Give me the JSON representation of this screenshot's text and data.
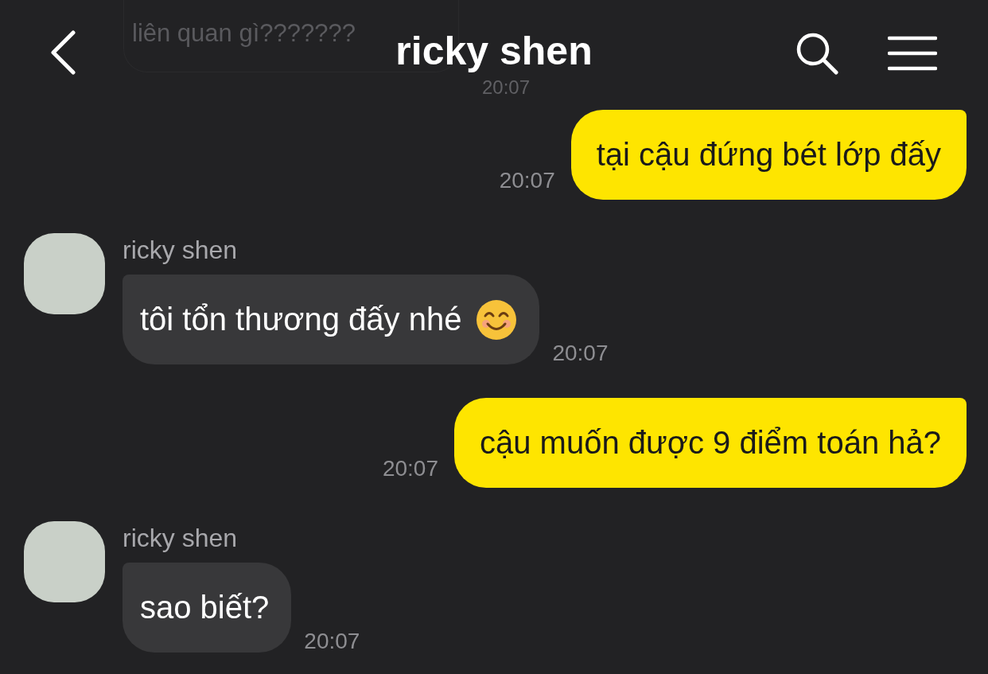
{
  "header": {
    "title": "ricky shen"
  },
  "faded_message": {
    "text": "liên quan gì???????",
    "time": "20:07"
  },
  "messages": [
    {
      "kind": "sent",
      "text": "tại cậu đứng bét lớp đấy",
      "time": "20:07"
    },
    {
      "kind": "received",
      "sender": "ricky shen",
      "text": "tôi tổn thương đấy nhé",
      "emoji_icon": true,
      "time": "20:07"
    },
    {
      "kind": "sent",
      "text": "cậu muốn được 9 điểm toán hả?",
      "time": "20:07"
    },
    {
      "kind": "received",
      "sender": "ricky shen",
      "text": "sao biết?",
      "emoji_icon": false,
      "time": "20:07"
    }
  ]
}
